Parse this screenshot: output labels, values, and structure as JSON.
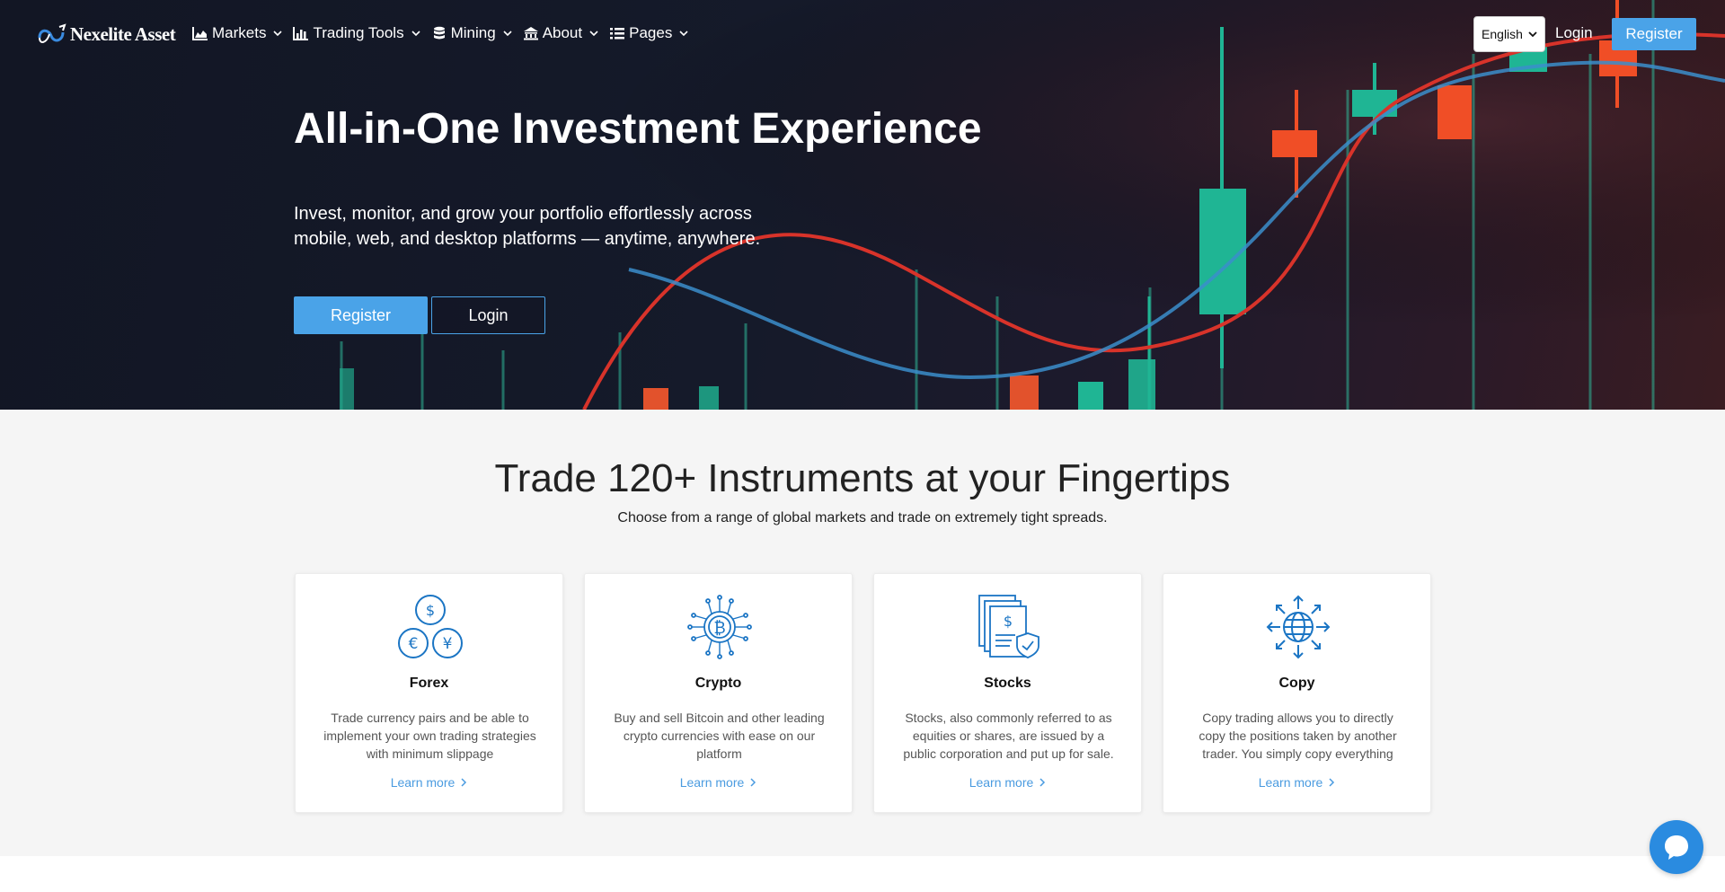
{
  "brand": {
    "name": "Nexelite Asset"
  },
  "nav": {
    "items": [
      {
        "label": "Markets",
        "icon": "area-chart-icon"
      },
      {
        "label": "Trading Tools",
        "icon": "bar-chart-icon"
      },
      {
        "label": "Mining",
        "icon": "database-icon"
      },
      {
        "label": "About",
        "icon": "bank-icon"
      },
      {
        "label": "Pages",
        "icon": "list-icon"
      }
    ],
    "language": "English",
    "login": "Login",
    "register": "Register"
  },
  "hero": {
    "title": "All-in-One Investment Experience",
    "subtitle": "Invest, monitor, and grow your portfolio effortlessly across mobile, web, and desktop platforms — anytime, anywhere.",
    "register": "Register",
    "login": "Login"
  },
  "instruments": {
    "title": "Trade 120+ Instruments at your Fingertips",
    "subtitle": "Choose from a range of global markets and trade on extremely tight spreads.",
    "cards": [
      {
        "title": "Forex",
        "icon": "currency-coins-icon",
        "description": "Trade currency pairs and be able to implement your own trading strategies with minimum slippage",
        "link": "Learn more"
      },
      {
        "title": "Crypto",
        "icon": "bitcoin-chip-icon",
        "description": "Buy and sell Bitcoin and other leading crypto currencies with ease on our platform",
        "link": "Learn more"
      },
      {
        "title": "Stocks",
        "icon": "stock-document-icon",
        "description": "Stocks, also commonly referred to as equities or shares, are issued by a public corporation and put up for sale.",
        "link": "Learn more"
      },
      {
        "title": "Copy",
        "icon": "globe-arrows-icon",
        "description": "Copy trading allows you to directly copy the positions taken by another trader. You simply copy everything",
        "link": "Learn more"
      }
    ]
  },
  "colors": {
    "accent": "#4aa3e8",
    "link": "#4a9be0",
    "icon": "#1b75c4",
    "chat": "#2a8be0"
  },
  "chat": {
    "icon": "chat-bubble-icon"
  }
}
